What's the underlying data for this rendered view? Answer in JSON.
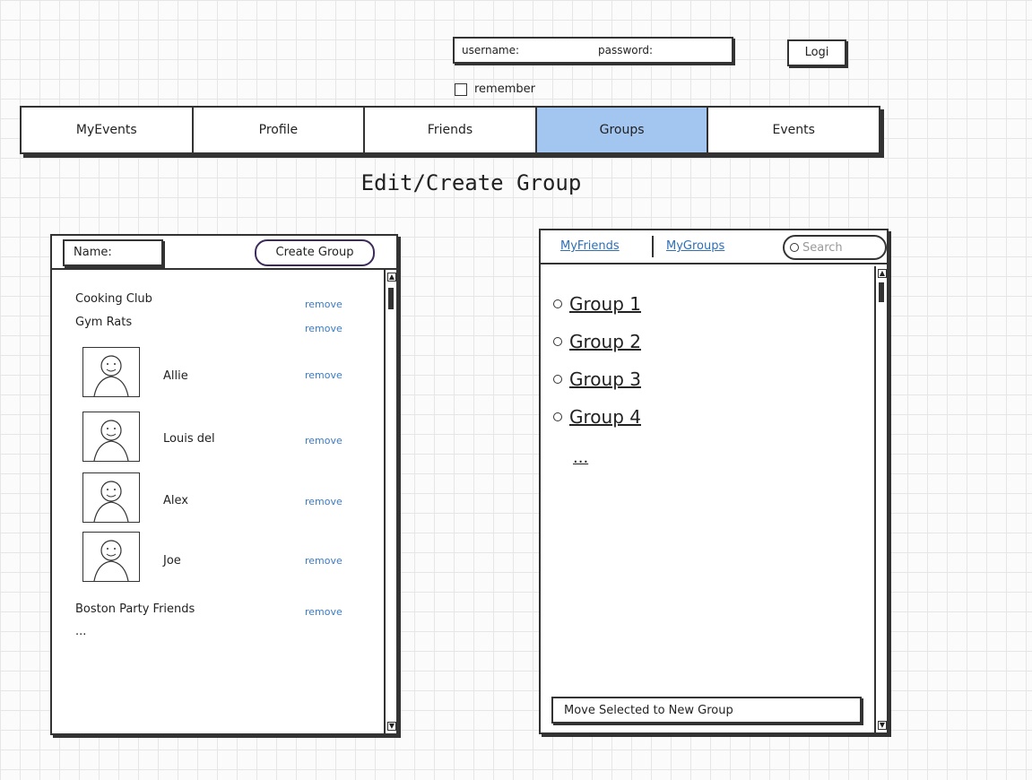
{
  "login": {
    "username_label": "username:",
    "password_label": "password:",
    "button_label": "Logi",
    "remember_label": "remember"
  },
  "nav": {
    "tabs": [
      {
        "label": "MyEvents"
      },
      {
        "label": "Profile"
      },
      {
        "label": "Friends"
      },
      {
        "label": "Groups"
      },
      {
        "label": "Events"
      }
    ],
    "active": "Groups",
    "active_color": "#a3c6f0"
  },
  "page_title": "Edit/Create Group",
  "left_panel": {
    "name_label": "Name:",
    "create_button": "Create Group",
    "items": [
      {
        "label": "Cooking Club",
        "action": "remove"
      },
      {
        "label": "Gym Rats",
        "action": "remove"
      },
      {
        "label": "Allie",
        "action": "remove"
      },
      {
        "label": "Louis del",
        "action": "remove"
      },
      {
        "label": "Alex",
        "action": "remove"
      },
      {
        "label": "Joe",
        "action": "remove"
      },
      {
        "label": "Boston Party Friends",
        "action": "remove"
      }
    ],
    "more": "..."
  },
  "right_panel": {
    "tabs": [
      {
        "label": "MyFriends"
      },
      {
        "label": "MyGroups"
      }
    ],
    "search_placeholder": "Search",
    "groups": [
      {
        "label": "Group 1"
      },
      {
        "label": "Group 2"
      },
      {
        "label": "Group 3"
      },
      {
        "label": "Group 4"
      }
    ],
    "more": "...",
    "move_button": "Move Selected to New Group"
  }
}
